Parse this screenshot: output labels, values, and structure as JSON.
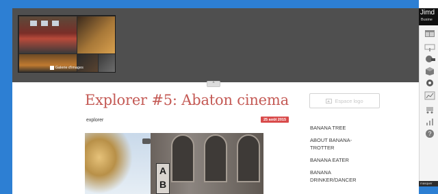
{
  "gallery": {
    "caption": "Galerie d'images"
  },
  "collapse_toggle": "^",
  "post": {
    "title": "Explorer #5: Abaton cinema",
    "category": "explorer",
    "date": "25 août 2015"
  },
  "logo_placeholder": {
    "label": "Espace logo"
  },
  "nav": {
    "items": [
      {
        "label": "BANANA TREE"
      },
      {
        "label": "ABOUT BANANA-TROTTER"
      },
      {
        "label": "BANANA EATER"
      },
      {
        "label": "BANANA DRINKER/DANCER"
      }
    ]
  },
  "toolbar": {
    "brand": "Jimd",
    "plan": "Busine",
    "footer_label": "masquer",
    "tools": [
      "layout-icon",
      "text-icon",
      "design-icon",
      "shop-box-icon",
      "settings-gear-icon",
      "stats-icon",
      "cart-icon",
      "chart-icon",
      "help-icon"
    ]
  },
  "colors": {
    "accent_blue": "#2d7fd3",
    "title_red": "#c45a55",
    "date_badge": "#d94b4b",
    "gallery_band": "#4f4f4f"
  }
}
